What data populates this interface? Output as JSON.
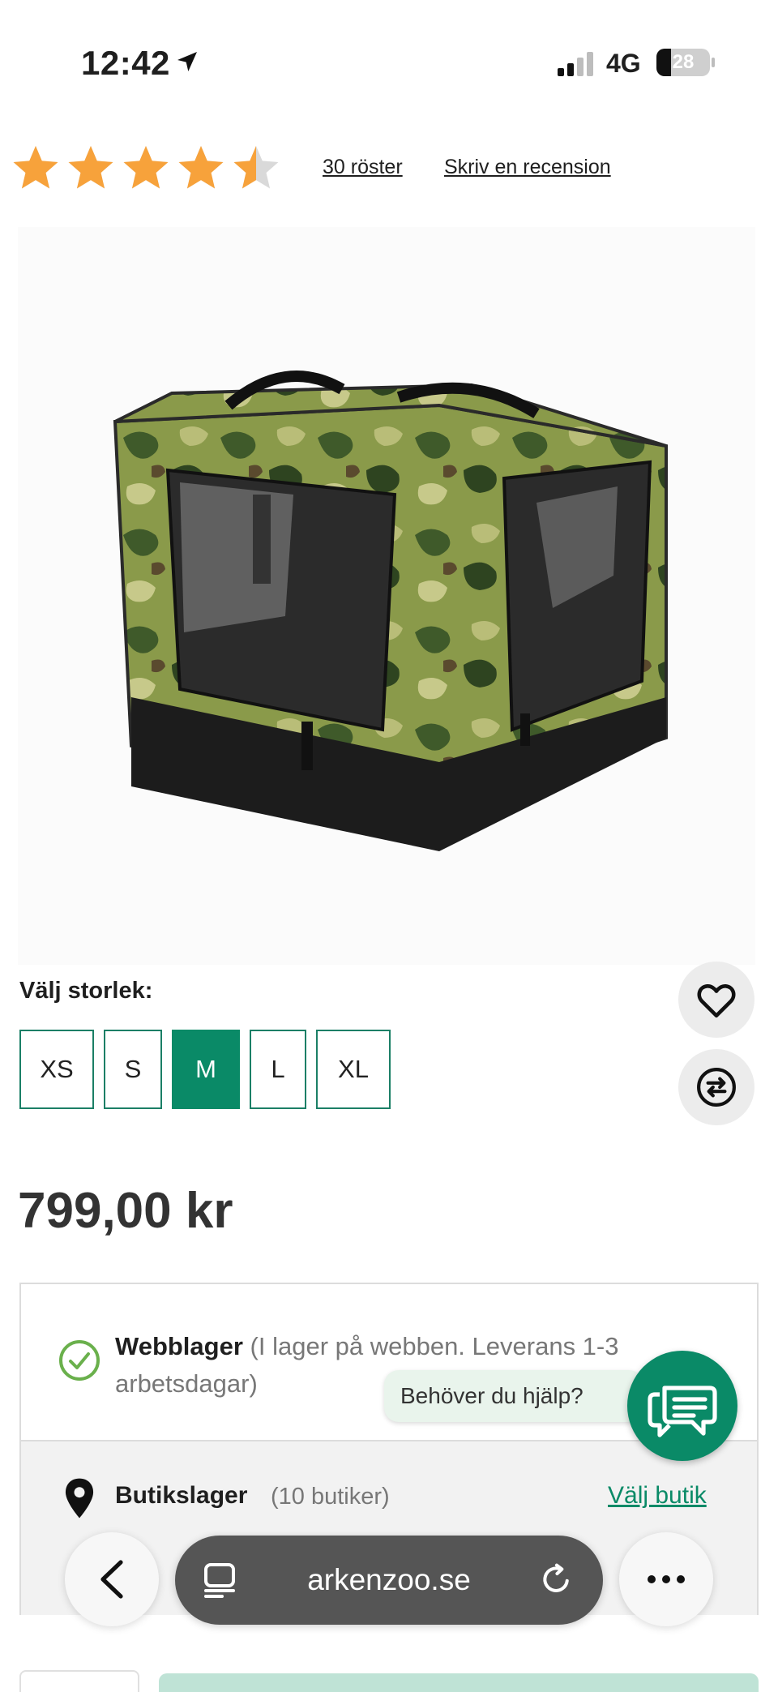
{
  "status_bar": {
    "time": "12:42",
    "network": "4G",
    "battery_level": "28",
    "battery_fraction": 0.28
  },
  "rating": {
    "stars_out_of_5": 4.5,
    "votes": "30 röster",
    "write_review": "Skriv en recension"
  },
  "product": {
    "image_alt": "Camouflage soft pet carrier",
    "size_label": "Välj storlek:",
    "sizes": [
      "XS",
      "S",
      "M",
      "L",
      "XL"
    ],
    "selected_size": "M",
    "price": "799,00 kr"
  },
  "stock": {
    "web_title": "Webblager",
    "web_detail": "(I lager på webben. Leverans 1-3 arbetsdagar)",
    "store_title": "Butikslager",
    "store_count": "(10 butiker)",
    "store_link": "Välj butik"
  },
  "help": {
    "bubble_text": "Behöver du hjälp?"
  },
  "browser": {
    "url": "arkenzoo.se"
  },
  "colors": {
    "brand_green": "#0a8a67",
    "star_orange": "#f7a23b"
  }
}
